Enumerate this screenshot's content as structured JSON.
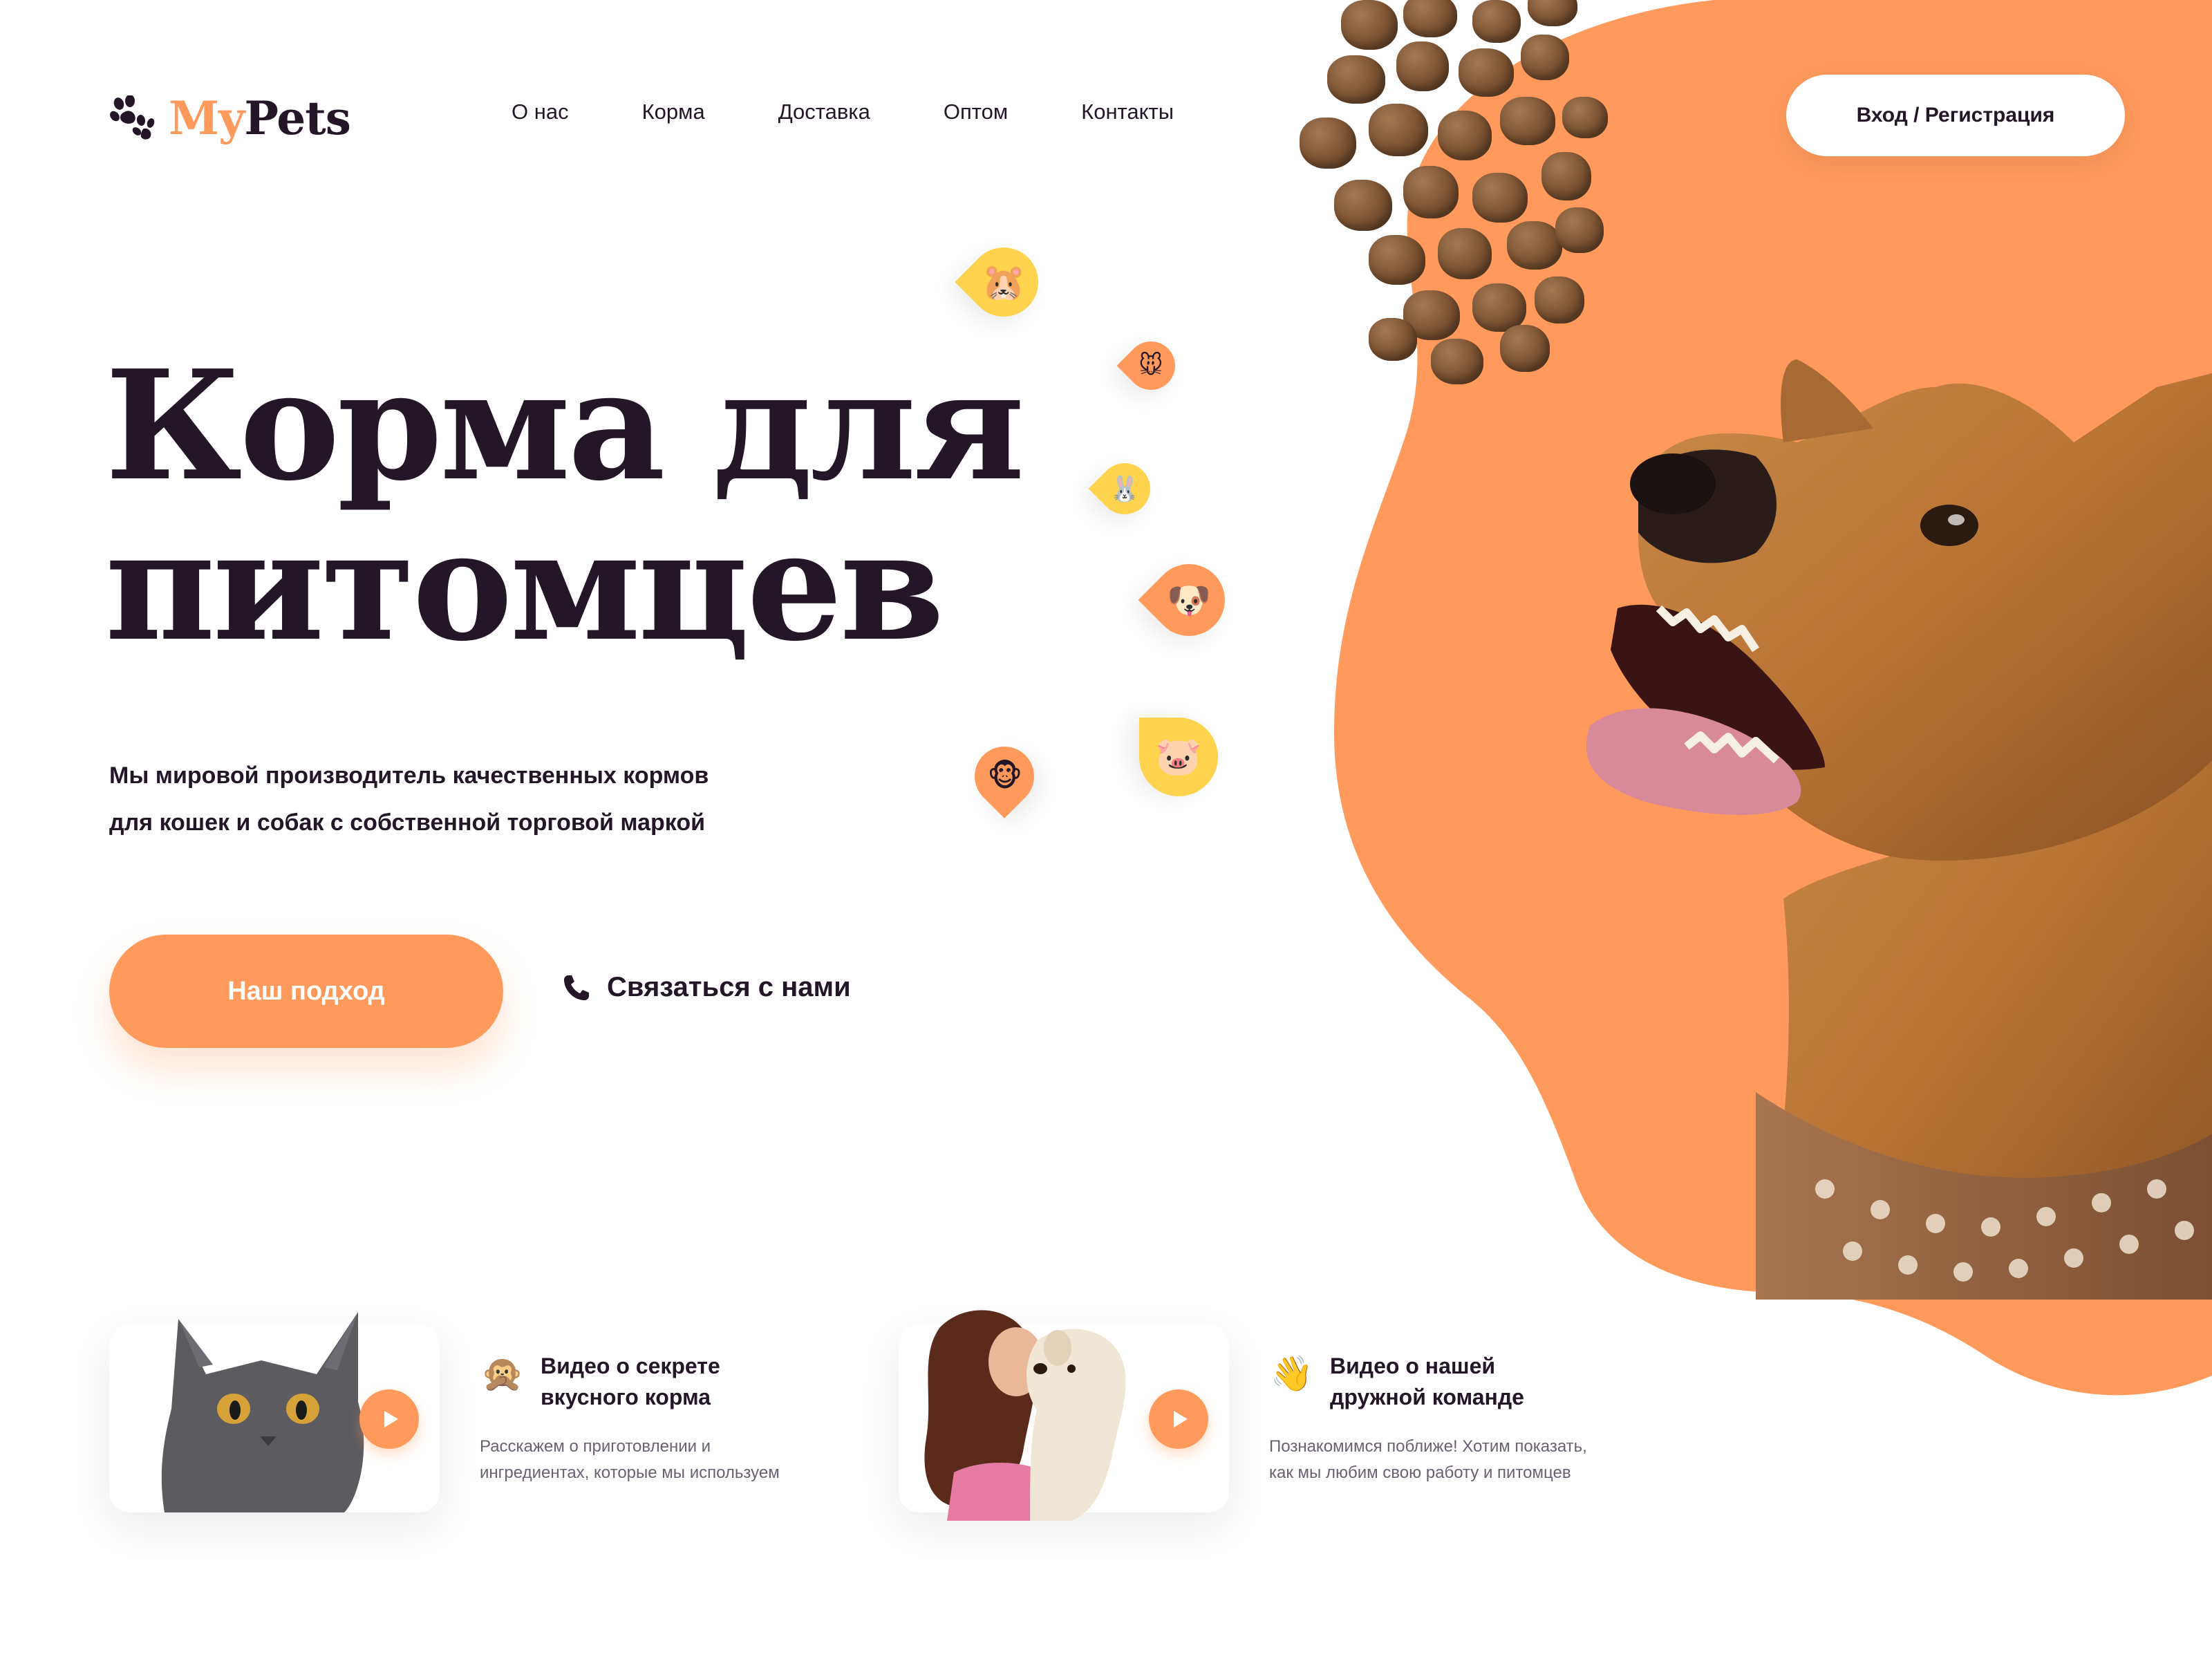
{
  "brand": {
    "logo_my": "My",
    "logo_pets": "Pets",
    "logo_icon": "paw-icon",
    "accent_color": "#ff9a5c",
    "text_color": "#231626",
    "pin_yellow": "#ffd34d"
  },
  "nav": {
    "items": [
      "О нас",
      "Корма",
      "Доставка",
      "Оптом",
      "Контакты"
    ]
  },
  "header": {
    "login_label": "Вход / Регистрация"
  },
  "hero": {
    "title_line1": "Корма для",
    "title_line2": "питомцев",
    "desc_line1": "Мы мировой производитель качественных кормов",
    "desc_line2": "для кошек и собак с собственной торговой маркой",
    "cta_label": "Наш подход",
    "contact_label": "Связаться с нами",
    "contact_icon": "phone-icon"
  },
  "pins": [
    {
      "icon": "hamster-face",
      "glyph": "🐹",
      "color": "#ffd34d"
    },
    {
      "icon": "mouse-face",
      "glyph": "🐭",
      "color": "#ff9a5c"
    },
    {
      "icon": "rabbit-face",
      "glyph": "🐰",
      "color": "#ffd34d"
    },
    {
      "icon": "dog-face",
      "glyph": "🐶",
      "color": "#ff9a5c"
    },
    {
      "icon": "pig-face",
      "glyph": "🐷",
      "color": "#ffd34d"
    },
    {
      "icon": "monkey-face",
      "glyph": "🐵",
      "color": "#ff9a5c"
    }
  ],
  "videos": [
    {
      "emoji": "🙊",
      "emoji_icon": "see-no-evil-monkey-icon",
      "title_line1": "Видео о секрете",
      "title_line2": "вкусного корма",
      "sub_line1": "Расскажем о приготовлении и",
      "sub_line2": "ингредиентах, которые мы используем"
    },
    {
      "emoji": "👋",
      "emoji_icon": "waving-hand-icon",
      "title_line1": "Видео о нашей",
      "title_line2": "дружной команде",
      "sub_line1": "Познакомимся поближе! Хотим показать,",
      "sub_line2": "как мы любим свою работу и питомцев"
    }
  ]
}
